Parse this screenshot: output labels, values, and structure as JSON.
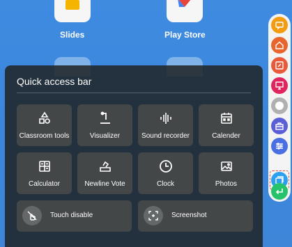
{
  "home": {
    "apps": [
      {
        "label": "Slides"
      },
      {
        "label": "Play Store"
      }
    ]
  },
  "quick_access": {
    "title": "Quick access bar",
    "tiles": [
      {
        "label": "Classroom tools",
        "icon": "shapes-icon"
      },
      {
        "label": "Visualizer",
        "icon": "visualizer-icon"
      },
      {
        "label": "Sound recorder",
        "icon": "sound-wave-icon"
      },
      {
        "label": "Calender",
        "icon": "calendar-icon"
      },
      {
        "label": "Calculator",
        "icon": "calculator-icon"
      },
      {
        "label": "Newline Vote",
        "icon": "vote-icon"
      },
      {
        "label": "Clock",
        "icon": "clock-icon"
      },
      {
        "label": "Photos",
        "icon": "photo-icon"
      }
    ],
    "wide_buttons": [
      {
        "label": "Touch disable",
        "icon": "touch-disable-icon"
      },
      {
        "label": "Screenshot",
        "icon": "screenshot-icon"
      }
    ]
  },
  "toolbar": {
    "buttons": [
      {
        "icon": "chat-icon",
        "color": "#f39c12"
      },
      {
        "icon": "home-icon",
        "color": "#e8662e"
      },
      {
        "icon": "annotate-icon",
        "color": "#e85a3a"
      },
      {
        "icon": "whiteboard-icon",
        "color": "#e0245e"
      },
      {
        "icon": "circle-icon",
        "color": "#9e9e9e"
      },
      {
        "icon": "toolbox-icon",
        "color": "#5b5fd6"
      },
      {
        "icon": "settings-sliders-icon",
        "color": "#4a6fe3"
      },
      {
        "icon": "window-icon",
        "color": "#2d9ff0"
      },
      {
        "icon": "return-icon",
        "color": "#27c26c"
      }
    ]
  }
}
